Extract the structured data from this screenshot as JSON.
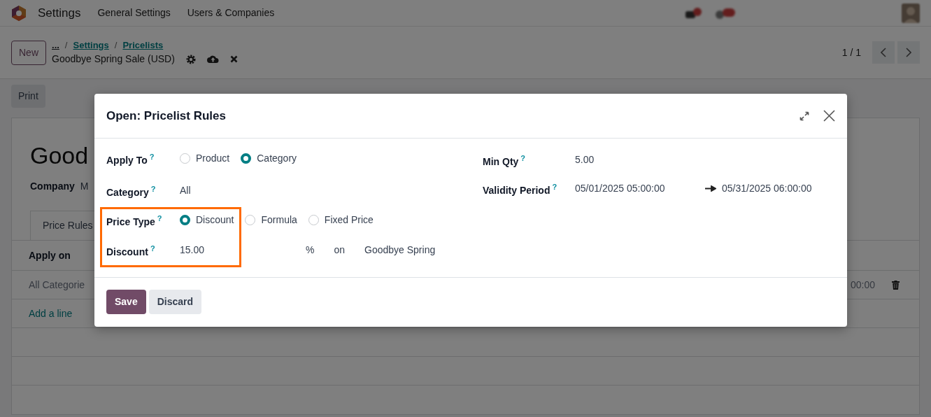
{
  "navbar": {
    "app": "Settings",
    "menus": [
      "General Settings",
      "Users & Companies"
    ]
  },
  "control_panel": {
    "new_button": "New",
    "breadcrumbs": [
      "...",
      "Settings",
      "Pricelists"
    ],
    "separator": "/",
    "record": "Goodbye Spring Sale (USD)",
    "pager": "1 / 1"
  },
  "print_button": "Print",
  "sheet": {
    "title": "Good",
    "company_label": "Company",
    "company_value": "M",
    "tabs": [
      {
        "label": "Price Rules",
        "selected": true
      }
    ],
    "column_1": "Apply on",
    "rows": [
      {
        "apply_on": "All Categorie",
        "column_end": "00:00"
      }
    ],
    "add_line": "Add a line"
  },
  "modal": {
    "title": "Open: Pricelist Rules",
    "left_fields": [
      {
        "kind": "radio",
        "label": "Apply To",
        "help": "?",
        "highlighted": false,
        "options": [
          {
            "label": "Product",
            "selected": false
          },
          {
            "label": "Category",
            "selected": true
          }
        ]
      },
      {
        "kind": "text",
        "label": "Category",
        "help": "?",
        "highlighted": false,
        "value": "All"
      },
      {
        "kind": "radio",
        "label": "Price Type",
        "help": "?",
        "highlighted": true,
        "options": [
          {
            "label": "Discount",
            "selected": true
          },
          {
            "label": "Formula",
            "selected": false
          },
          {
            "label": "Fixed Price",
            "selected": false
          }
        ]
      },
      {
        "kind": "discount",
        "label": "Discount",
        "help": "?",
        "highlighted": true,
        "value": "15.00",
        "unit": "%",
        "on": "on",
        "base": "Goodbye Spring"
      }
    ],
    "right_fields": [
      {
        "kind": "text",
        "label": "Min Qty",
        "help": "?",
        "value": "5.00"
      },
      {
        "kind": "range",
        "label": "Validity Period",
        "help": "?",
        "start": "05/01/2025 05:00:00",
        "end": "05/31/2025 06:00:00"
      }
    ],
    "buttons": [
      {
        "label": "Save",
        "kind": "primary"
      },
      {
        "label": "Discard",
        "kind": "secondary"
      }
    ]
  }
}
